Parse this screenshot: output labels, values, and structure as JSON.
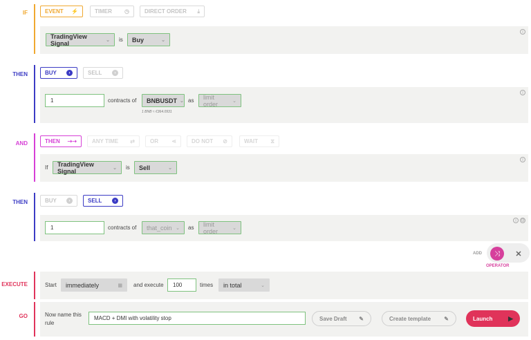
{
  "if_block": {
    "keyword": "IF",
    "tabs": [
      {
        "label": "EVENT",
        "icon": "⚡"
      },
      {
        "label": "TIMER",
        "icon": "◷"
      },
      {
        "label": "DIRECT ORDER",
        "icon": "⤓"
      }
    ],
    "condition": {
      "source": "TradingView Signal",
      "is": "is",
      "value": "Buy"
    }
  },
  "then_block_1": {
    "keyword": "THEN",
    "buy_label": "BUY",
    "sell_label": "SELL",
    "quantity": "1",
    "contracts_of": "contracts of",
    "coin": "BNBUSDT",
    "as": "as",
    "order_type": "limit order",
    "rate_hint": "1 BNB ≈ €364.0931"
  },
  "and_block": {
    "keyword": "AND",
    "options": [
      {
        "label": "THEN",
        "icon": "⇢⇢"
      },
      {
        "label": "ANY TIME",
        "icon": "⇄"
      },
      {
        "label": "OR",
        "icon": "⋖"
      },
      {
        "label": "DO NOT",
        "icon": "⊘"
      },
      {
        "label": "WAIT",
        "icon": "⧖"
      }
    ],
    "condition": {
      "if": "If",
      "source": "TradingView Signal",
      "is": "is",
      "value": "Sell"
    }
  },
  "then_block_2": {
    "keyword": "THEN",
    "buy_label": "BUY",
    "sell_label": "SELL",
    "quantity": "1",
    "contracts_of": "contracts of",
    "coin": "that_coin",
    "as": "as",
    "order_type": "limit order"
  },
  "add": {
    "label": "ADD",
    "operator_label": "OPERATOR"
  },
  "execute_block": {
    "keyword": "EXECUTE",
    "start_label": "Start",
    "start_value": "immediately",
    "and_execute": "and execute",
    "times_value": "100",
    "times_label": "times",
    "scope": "in total"
  },
  "go_block": {
    "keyword": "GO",
    "name_prompt": "Now name this rule",
    "rule_name": "MACD + DMI with volatility stop",
    "save_draft": "Save Draft",
    "create_template": "Create template",
    "launch": "Launch"
  },
  "colors": {
    "if": "#f0a830",
    "then": "#3b3bc4",
    "and": "#d63fd6",
    "execute": "#e0335a",
    "go": "#e0335a",
    "accent_green": "#7ec27e",
    "operator": "#d63f9c"
  }
}
